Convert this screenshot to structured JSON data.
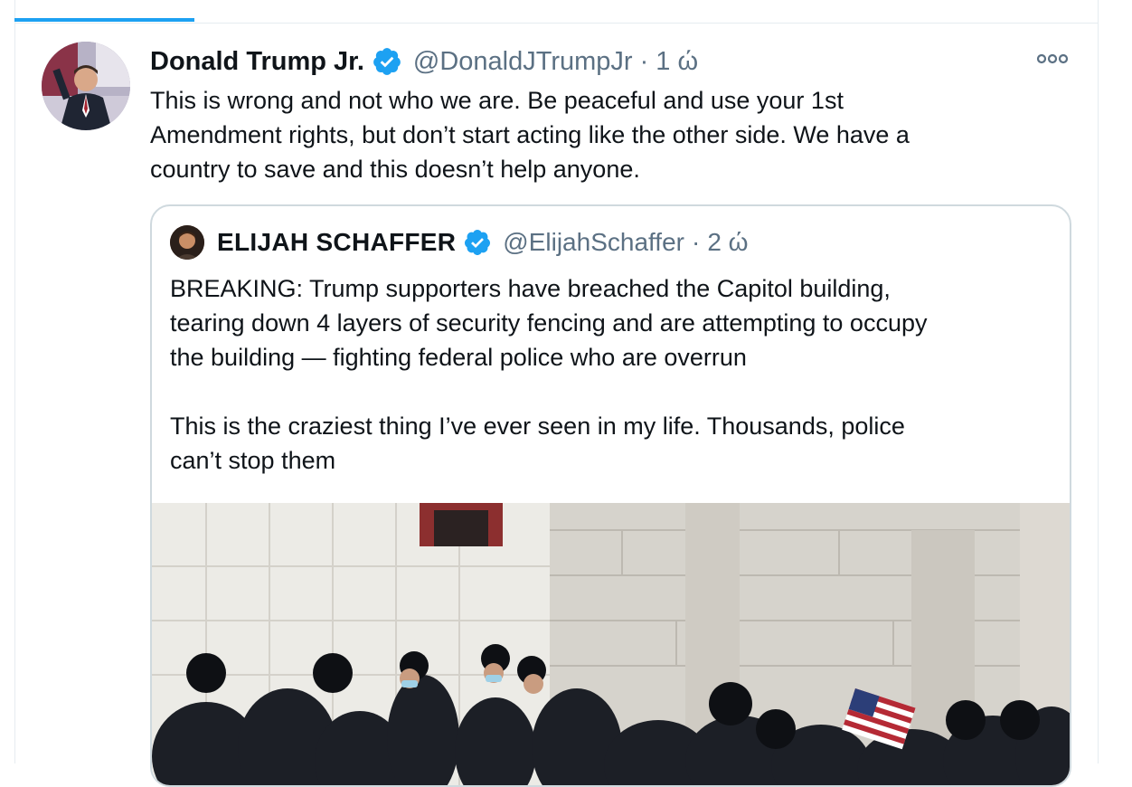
{
  "tweet": {
    "author_name": "Donald Trump Jr.",
    "handle": "@DonaldJTrumpJr",
    "separator": "·",
    "time": "1 ώ",
    "text_lines": [
      "This is wrong and not who we are. Be peaceful and use your 1st",
      "Amendment rights, but don’t start acting like the other side. We have a",
      "country to save and this doesn’t help anyone."
    ]
  },
  "quoted": {
    "author_name": "ELIJAH SCHAFFER",
    "handle": "@ElijahSchaffer",
    "separator": "·",
    "time": "2 ώ",
    "text_lines": [
      "BREAKING: Trump supporters have breached the Capitol building,",
      "tearing down 4 layers of security fencing and are attempting to occupy",
      "the building — fighting federal police who are overrun",
      "",
      "This is the craziest thing I’ve ever seen in my life. Thousands, police",
      "can’t stop them"
    ]
  },
  "icons": {
    "verified": "verified-badge-icon",
    "more": "more-options-icon"
  },
  "colors": {
    "accent": "#1da1f2",
    "text": "#0f1419",
    "secondary_text": "#5b7083",
    "border": "#cfd9de"
  }
}
